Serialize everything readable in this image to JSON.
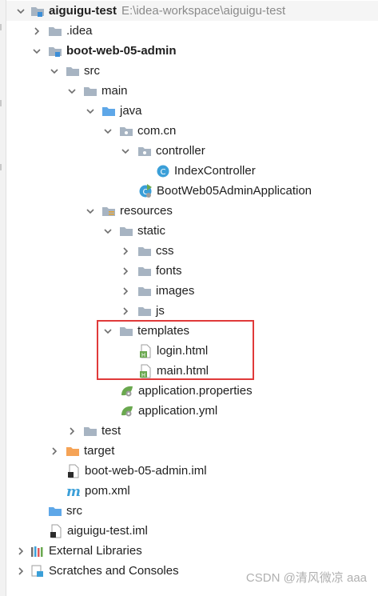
{
  "tree": {
    "project_root": {
      "name": "aiguigu-test",
      "path": "E:\\idea-workspace\\aiguigu-test"
    },
    "idea_folder": ".idea",
    "module": "boot-web-05-admin",
    "src": "src",
    "main": "main",
    "java": "java",
    "package": "com.cn",
    "controller_pkg": "controller",
    "index_controller": "IndexController",
    "app_class": "BootWeb05AdminApplication",
    "resources": "resources",
    "static": "static",
    "css": "css",
    "fonts": "fonts",
    "images": "images",
    "js": "js",
    "templates": "templates",
    "login_html": "login.html",
    "main_html": "main.html",
    "app_properties": "application.properties",
    "app_yml": "application.yml",
    "test": "test",
    "target": "target",
    "module_iml": "boot-web-05-admin.iml",
    "pom": "pom.xml",
    "root_src": "src",
    "root_iml": "aiguigu-test.iml",
    "external_libraries": "External Libraries",
    "scratches": "Scratches and Consoles"
  },
  "watermark": "CSDN @清风微凉 aaa",
  "colors": {
    "folder": "#a7b4c2",
    "source_folder": "#5ea7e8",
    "target_folder": "#f5a356",
    "highlight": "#e03a3a",
    "class_icon": "#3b9fd8",
    "spring": "#6aa84f"
  }
}
